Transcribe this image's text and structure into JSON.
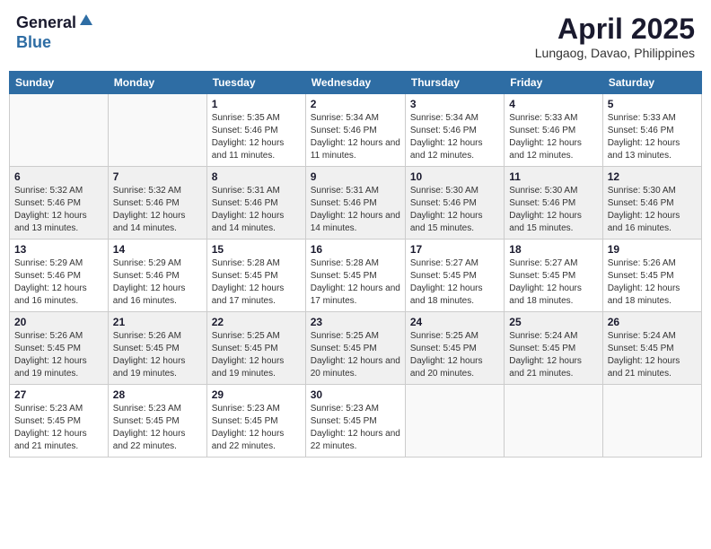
{
  "header": {
    "logo_general": "General",
    "logo_blue": "Blue",
    "month_year": "April 2025",
    "location": "Lungaog, Davao, Philippines"
  },
  "calendar": {
    "days_of_week": [
      "Sunday",
      "Monday",
      "Tuesday",
      "Wednesday",
      "Thursday",
      "Friday",
      "Saturday"
    ],
    "weeks": [
      [
        {
          "day": "",
          "info": ""
        },
        {
          "day": "",
          "info": ""
        },
        {
          "day": "1",
          "info": "Sunrise: 5:35 AM\nSunset: 5:46 PM\nDaylight: 12 hours and 11 minutes."
        },
        {
          "day": "2",
          "info": "Sunrise: 5:34 AM\nSunset: 5:46 PM\nDaylight: 12 hours and 11 minutes."
        },
        {
          "day": "3",
          "info": "Sunrise: 5:34 AM\nSunset: 5:46 PM\nDaylight: 12 hours and 12 minutes."
        },
        {
          "day": "4",
          "info": "Sunrise: 5:33 AM\nSunset: 5:46 PM\nDaylight: 12 hours and 12 minutes."
        },
        {
          "day": "5",
          "info": "Sunrise: 5:33 AM\nSunset: 5:46 PM\nDaylight: 12 hours and 13 minutes."
        }
      ],
      [
        {
          "day": "6",
          "info": "Sunrise: 5:32 AM\nSunset: 5:46 PM\nDaylight: 12 hours and 13 minutes."
        },
        {
          "day": "7",
          "info": "Sunrise: 5:32 AM\nSunset: 5:46 PM\nDaylight: 12 hours and 14 minutes."
        },
        {
          "day": "8",
          "info": "Sunrise: 5:31 AM\nSunset: 5:46 PM\nDaylight: 12 hours and 14 minutes."
        },
        {
          "day": "9",
          "info": "Sunrise: 5:31 AM\nSunset: 5:46 PM\nDaylight: 12 hours and 14 minutes."
        },
        {
          "day": "10",
          "info": "Sunrise: 5:30 AM\nSunset: 5:46 PM\nDaylight: 12 hours and 15 minutes."
        },
        {
          "day": "11",
          "info": "Sunrise: 5:30 AM\nSunset: 5:46 PM\nDaylight: 12 hours and 15 minutes."
        },
        {
          "day": "12",
          "info": "Sunrise: 5:30 AM\nSunset: 5:46 PM\nDaylight: 12 hours and 16 minutes."
        }
      ],
      [
        {
          "day": "13",
          "info": "Sunrise: 5:29 AM\nSunset: 5:46 PM\nDaylight: 12 hours and 16 minutes."
        },
        {
          "day": "14",
          "info": "Sunrise: 5:29 AM\nSunset: 5:46 PM\nDaylight: 12 hours and 16 minutes."
        },
        {
          "day": "15",
          "info": "Sunrise: 5:28 AM\nSunset: 5:45 PM\nDaylight: 12 hours and 17 minutes."
        },
        {
          "day": "16",
          "info": "Sunrise: 5:28 AM\nSunset: 5:45 PM\nDaylight: 12 hours and 17 minutes."
        },
        {
          "day": "17",
          "info": "Sunrise: 5:27 AM\nSunset: 5:45 PM\nDaylight: 12 hours and 18 minutes."
        },
        {
          "day": "18",
          "info": "Sunrise: 5:27 AM\nSunset: 5:45 PM\nDaylight: 12 hours and 18 minutes."
        },
        {
          "day": "19",
          "info": "Sunrise: 5:26 AM\nSunset: 5:45 PM\nDaylight: 12 hours and 18 minutes."
        }
      ],
      [
        {
          "day": "20",
          "info": "Sunrise: 5:26 AM\nSunset: 5:45 PM\nDaylight: 12 hours and 19 minutes."
        },
        {
          "day": "21",
          "info": "Sunrise: 5:26 AM\nSunset: 5:45 PM\nDaylight: 12 hours and 19 minutes."
        },
        {
          "day": "22",
          "info": "Sunrise: 5:25 AM\nSunset: 5:45 PM\nDaylight: 12 hours and 19 minutes."
        },
        {
          "day": "23",
          "info": "Sunrise: 5:25 AM\nSunset: 5:45 PM\nDaylight: 12 hours and 20 minutes."
        },
        {
          "day": "24",
          "info": "Sunrise: 5:25 AM\nSunset: 5:45 PM\nDaylight: 12 hours and 20 minutes."
        },
        {
          "day": "25",
          "info": "Sunrise: 5:24 AM\nSunset: 5:45 PM\nDaylight: 12 hours and 21 minutes."
        },
        {
          "day": "26",
          "info": "Sunrise: 5:24 AM\nSunset: 5:45 PM\nDaylight: 12 hours and 21 minutes."
        }
      ],
      [
        {
          "day": "27",
          "info": "Sunrise: 5:23 AM\nSunset: 5:45 PM\nDaylight: 12 hours and 21 minutes."
        },
        {
          "day": "28",
          "info": "Sunrise: 5:23 AM\nSunset: 5:45 PM\nDaylight: 12 hours and 22 minutes."
        },
        {
          "day": "29",
          "info": "Sunrise: 5:23 AM\nSunset: 5:45 PM\nDaylight: 12 hours and 22 minutes."
        },
        {
          "day": "30",
          "info": "Sunrise: 5:23 AM\nSunset: 5:45 PM\nDaylight: 12 hours and 22 minutes."
        },
        {
          "day": "",
          "info": ""
        },
        {
          "day": "",
          "info": ""
        },
        {
          "day": "",
          "info": ""
        }
      ]
    ]
  }
}
